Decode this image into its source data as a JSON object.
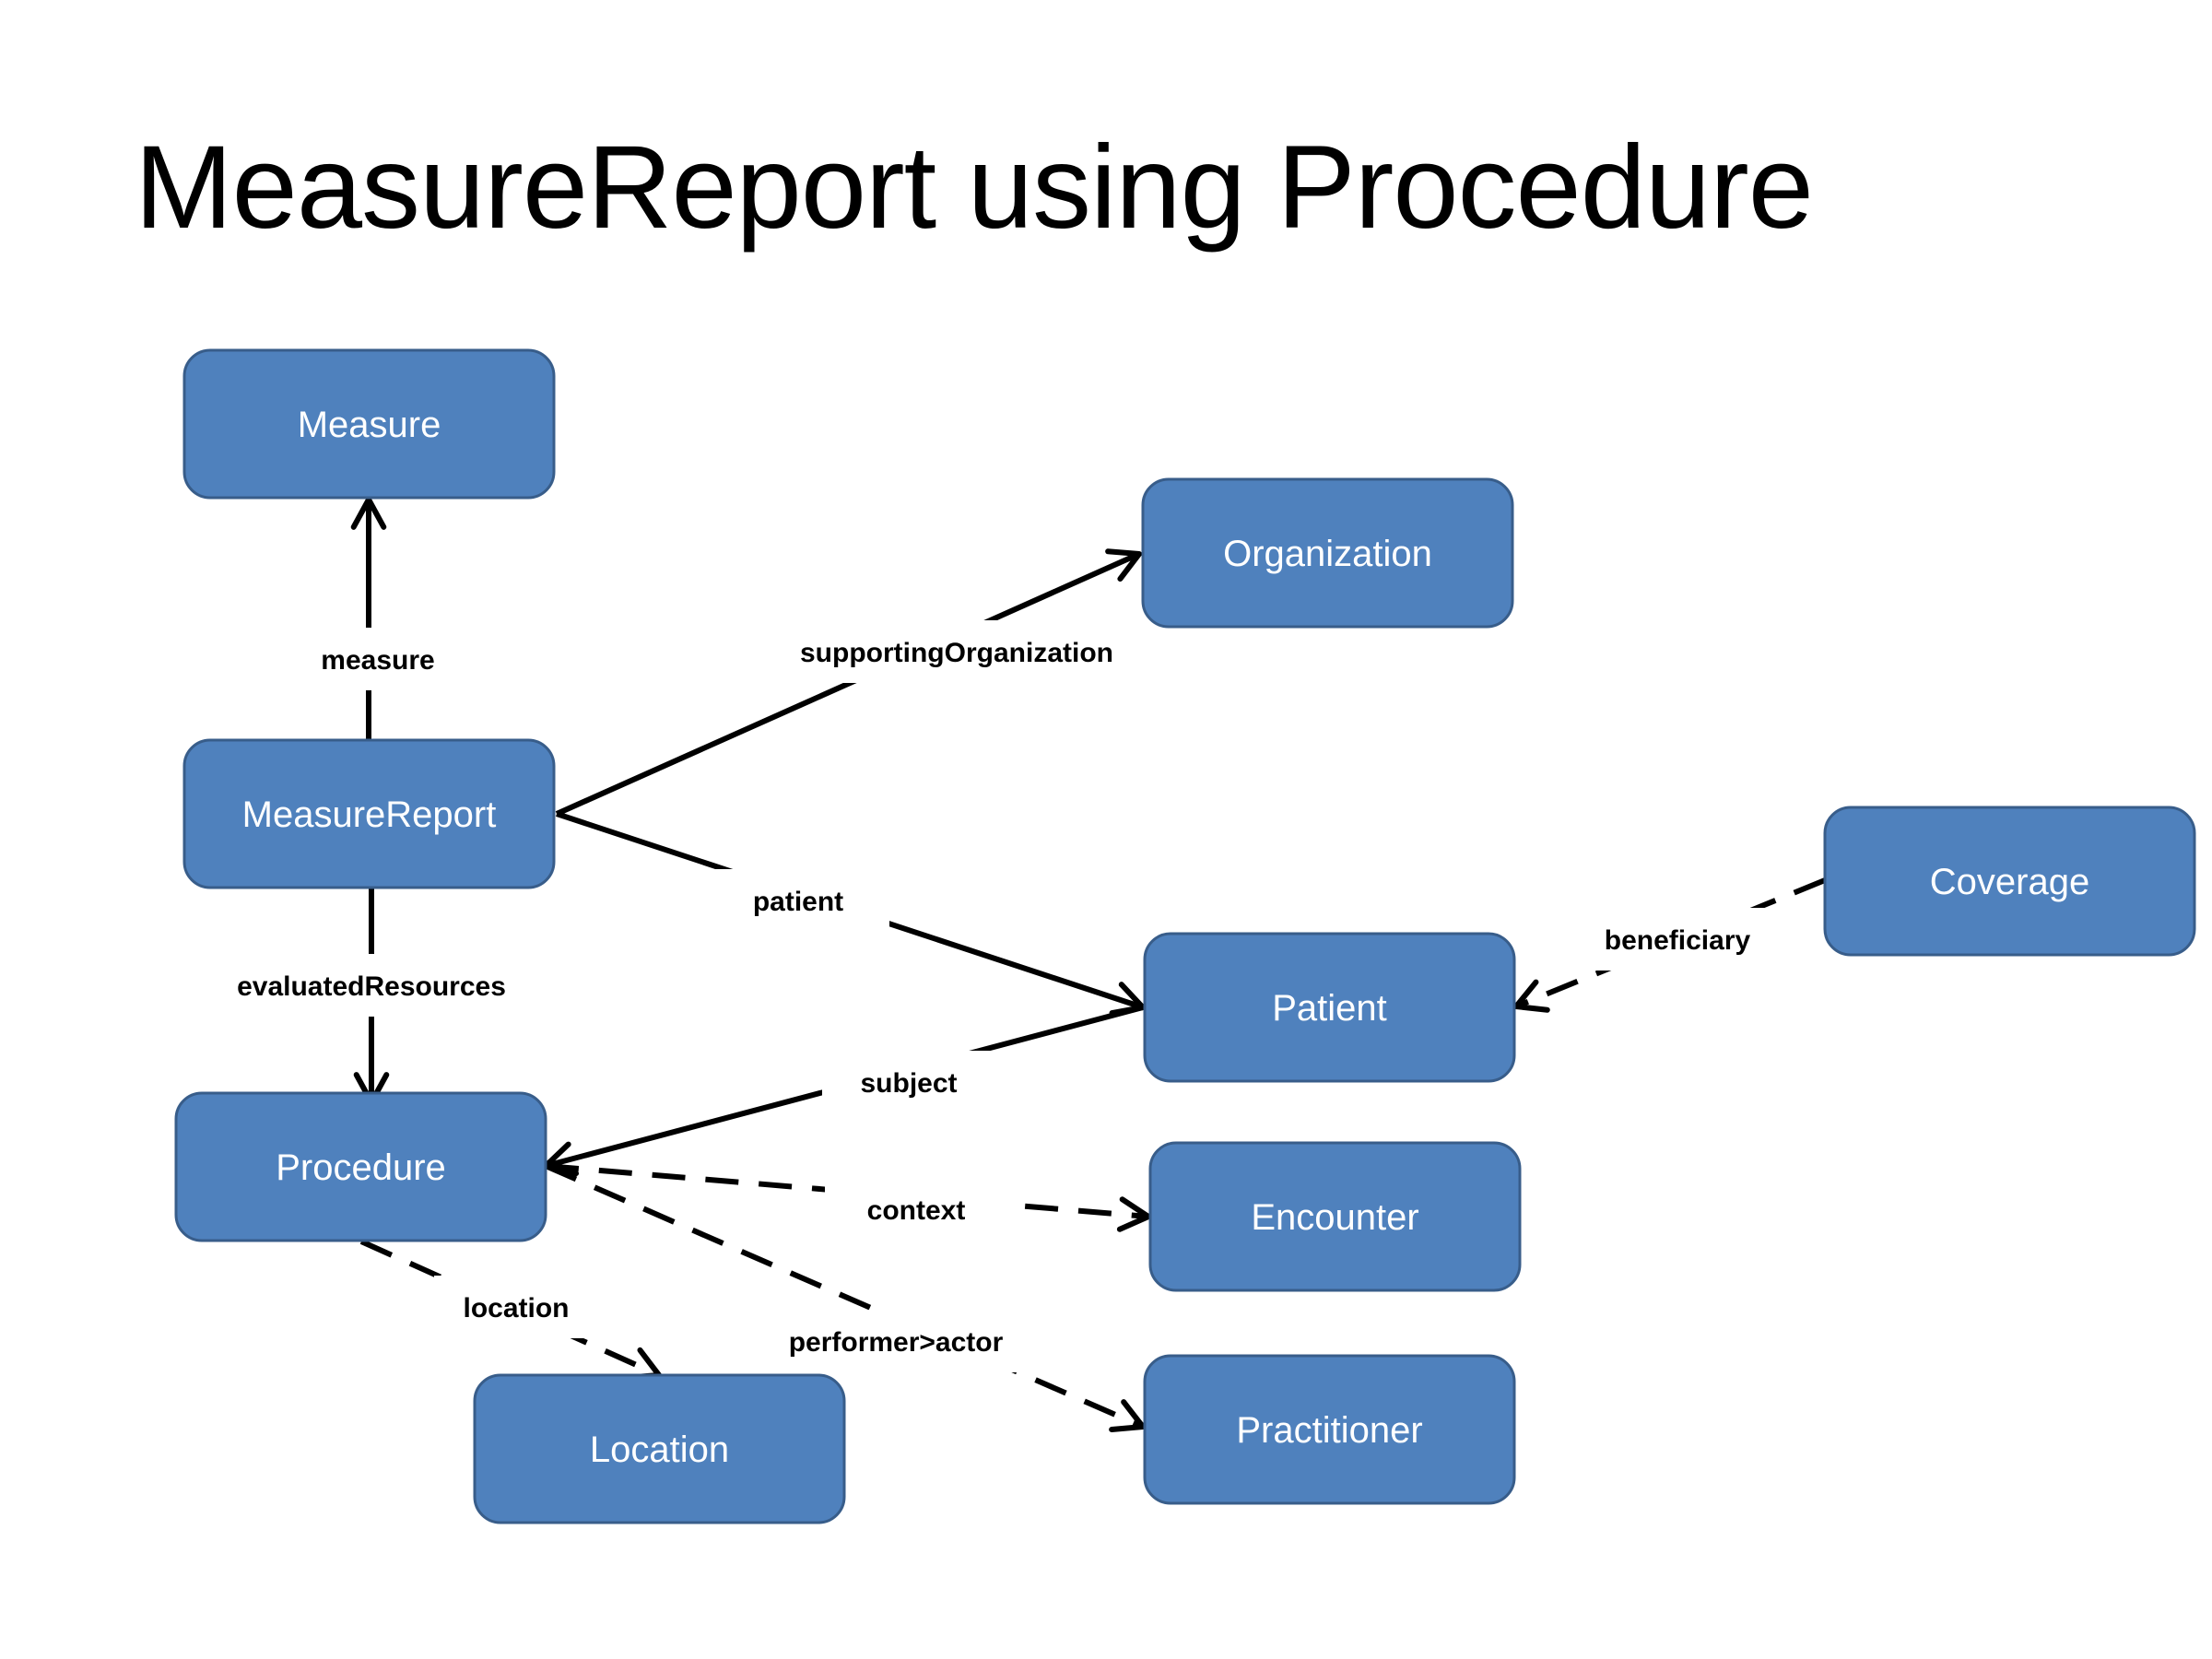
{
  "title": "MeasureReport using Procedure",
  "colors": {
    "node_fill": "#4F81BD",
    "node_border": "#385D8A",
    "node_text": "#FFFFFF",
    "edge": "#000000"
  },
  "nodes": [
    {
      "id": "measure",
      "label": "Measure"
    },
    {
      "id": "organization",
      "label": "Organization"
    },
    {
      "id": "measurereport",
      "label": "MeasureReport"
    },
    {
      "id": "coverage",
      "label": "Coverage"
    },
    {
      "id": "patient",
      "label": "Patient"
    },
    {
      "id": "procedure",
      "label": "Procedure"
    },
    {
      "id": "encounter",
      "label": "Encounter"
    },
    {
      "id": "practitioner",
      "label": "Practitioner"
    },
    {
      "id": "location",
      "label": "Location"
    }
  ],
  "edges": [
    {
      "id": "measure",
      "from": "measurereport",
      "to": "measure",
      "label": "measure",
      "style": "solid"
    },
    {
      "id": "evaluatedResources",
      "from": "measurereport",
      "to": "procedure",
      "label": "evaluatedResources",
      "style": "solid"
    },
    {
      "id": "supportingOrganization",
      "from": "measurereport",
      "to": "organization",
      "label": "supportingOrganization",
      "style": "solid"
    },
    {
      "id": "patient",
      "from": "measurereport",
      "to": "patient",
      "label": "patient",
      "style": "solid"
    },
    {
      "id": "subject",
      "from": "procedure",
      "to": "patient",
      "label": "subject",
      "style": "solid"
    },
    {
      "id": "context",
      "from": "procedure",
      "to": "encounter",
      "label": "context",
      "style": "dashed"
    },
    {
      "id": "performer",
      "from": "procedure",
      "to": "practitioner",
      "label": "performer>actor",
      "style": "dashed"
    },
    {
      "id": "location",
      "from": "procedure",
      "to": "location",
      "label": "location",
      "style": "dashed"
    },
    {
      "id": "beneficiary",
      "from": "coverage",
      "to": "patient",
      "label": "beneficiary",
      "style": "dashed"
    }
  ]
}
